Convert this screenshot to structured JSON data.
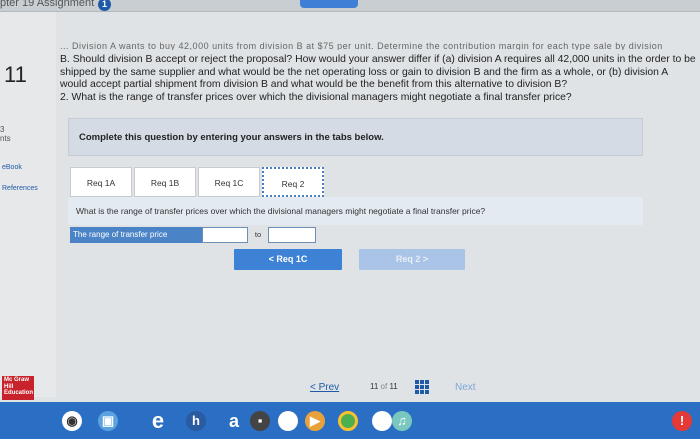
{
  "header": {
    "title": "pter 19 Assignment",
    "badge": "1"
  },
  "sidebar": {
    "question_number": "11",
    "points_value": "3",
    "points_label": "nts",
    "ebook_link": "eBook",
    "references_link": "References"
  },
  "question": {
    "cut_off_line": "... Division A wants to buy 42,000 units from division B at $75 per unit. Determine the contribution margin for each type sale by division",
    "part_b": "B. Should division B accept or reject the proposal? How would your answer differ if (a) division A requires all 42,000 units in the order to be shipped by the same supplier and what would be the net operating loss or gain to division B and the firm as a whole, or (b) division A would accept partial shipment from division B and what would be the benefit from this alternative to division B?",
    "part_2": "2. What is the range of transfer prices over which the divisional managers might negotiate a final transfer price?"
  },
  "instructions": "Complete this question by entering your answers in the tabs below.",
  "tabs": [
    {
      "label": "Req 1A"
    },
    {
      "label": "Req 1B"
    },
    {
      "label": "Req 1C"
    },
    {
      "label": "Req 2"
    }
  ],
  "req2": {
    "prompt": "What is the range of transfer prices over which the divisional managers might negotiate a final transfer price?",
    "range_label": "The range of transfer price",
    "from_value": "",
    "to_label": "to",
    "to_value": ""
  },
  "nav": {
    "prev_button": "<  Req 1C",
    "next_button": "Req 2  >"
  },
  "footer": {
    "logo_text": "Mc Graw Hill Education",
    "prev_link": "< Prev",
    "page_current": "11",
    "page_of": "of",
    "page_total": "11",
    "next_link": "Next"
  },
  "colors": {
    "accent": "#3e82d6",
    "taskbar": "#2b6fc4",
    "brand_red": "#c8232c"
  }
}
